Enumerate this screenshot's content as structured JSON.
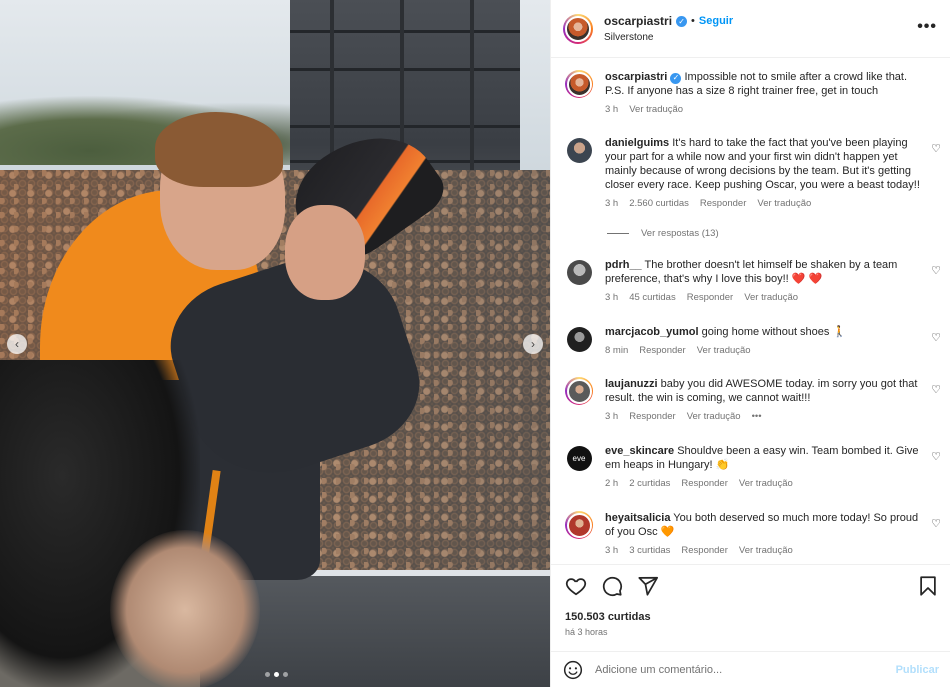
{
  "header": {
    "username": "oscarpiastri",
    "follow_label": "Seguir",
    "location": "Silverstone",
    "more_label": "•••"
  },
  "caption": {
    "username": "oscarpiastri",
    "text": "Impossible not to smile after a crowd like that. P.S. If anyone has a size 8 right trainer free, get in touch",
    "time": "3 h",
    "translate": "Ver tradução"
  },
  "comments": [
    {
      "username": "danielguims",
      "text": "It's hard to take the fact that you've been playing your part for a while now and your first win didn't happen yet mainly because of wrong decisions by the team. But it's getting closer every race. Keep pushing Oscar, you were a beast today!!",
      "time": "3 h",
      "likes": "2.560 curtidas",
      "reply": "Responder",
      "translate": "Ver tradução"
    },
    {
      "username": "pdrh__",
      "text": "The brother doesn't let himself be shaken by a team preference, that's why I love this boy!! ❤️ ❤️",
      "time": "3 h",
      "likes": "45 curtidas",
      "reply": "Responder",
      "translate": "Ver tradução"
    },
    {
      "username": "marcjacob_yumol",
      "text": "going home without shoes 🚶",
      "time": "8 min",
      "reply": "Responder",
      "translate": "Ver tradução"
    },
    {
      "username": "laujanuzzi",
      "text": "baby you did AWESOME today. im sorry you got that result. the win is coming, we cannot wait!!!",
      "time": "3 h",
      "reply": "Responder",
      "translate": "Ver tradução",
      "more": "•••"
    },
    {
      "username": "eve_skincare",
      "text": "Shouldve been a easy win. Team bombed it. Give em heaps in Hungary! 👏",
      "time": "2 h",
      "likes": "2 curtidas",
      "reply": "Responder",
      "translate": "Ver tradução"
    },
    {
      "username": "heyaitsalicia",
      "text": "You both deserved so much more today! So proud of you Osc 🧡",
      "time": "3 h",
      "likes": "3 curtidas",
      "reply": "Responder",
      "translate": "Ver tradução"
    }
  ],
  "view_replies": "Ver respostas (13)",
  "footer": {
    "likes": "150.503 curtidas",
    "time_ago": "há 3 horas",
    "comment_placeholder": "Adicione um comentário...",
    "publish_label": "Publicar"
  },
  "icons": {
    "like": "heart-icon",
    "comment": "comment-icon",
    "share": "send-icon",
    "save": "bookmark-icon",
    "emoji": "emoji-icon"
  },
  "carousel": {
    "prev": "‹",
    "next": "›",
    "slides": 3,
    "active_slide": 2
  },
  "colors": {
    "accent": "#0095f6",
    "verified": "#3897f0",
    "publish_disabled": "#b2dffc"
  }
}
